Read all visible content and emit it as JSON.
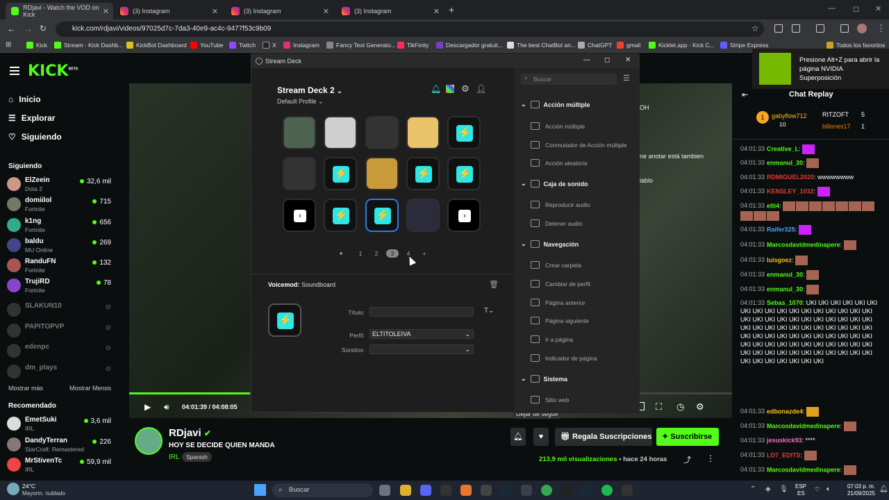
{
  "browser": {
    "tabs": [
      {
        "title": "RDjavi - Watch the VOD on Kick",
        "type": "kick",
        "active": true
      },
      {
        "title": "(3) Instagram",
        "type": "ig"
      },
      {
        "title": "(3) Instagram",
        "type": "ig"
      },
      {
        "title": "(3) Instagram",
        "type": "ig"
      }
    ],
    "url": "kick.com/rdjavi/videos/97025d7c-7da3-40e9-ac4c-9477f53c9b09",
    "bookmarks": [
      "Kick",
      "Stream - Kick Dashb...",
      "KickBot Dashboard",
      "YouTube",
      "Twitch",
      "X",
      "Instagram",
      "Fancy Text Generato...",
      "TikFinity",
      "Descargador gratuit...",
      "The best ChatBot an...",
      "ChatGPT",
      "gmail",
      "Kicklet.app - Kick C...",
      "Stripe Express"
    ],
    "all_favorites": "Todos los favoritos"
  },
  "kick": {
    "logo": "KICK",
    "logo_badge": "BETA",
    "nav": [
      "Inicio",
      "Explorar",
      "Siguiendo"
    ],
    "following_title": "Siguiendo",
    "following": [
      {
        "name": "ElZeein",
        "game": "Dota 2",
        "viewers": "32,6 mil"
      },
      {
        "name": "domiilol",
        "game": "Fortnite",
        "viewers": "715"
      },
      {
        "name": "k1ng",
        "game": "Fortnite",
        "viewers": "656"
      },
      {
        "name": "baldu",
        "game": "MU Online",
        "viewers": "269"
      },
      {
        "name": "RanduFN",
        "game": "Fortnite",
        "viewers": "132"
      },
      {
        "name": "TrujiRD",
        "game": "Fortnite",
        "viewers": "78"
      }
    ],
    "offline": [
      "SLAKUN10",
      "PAPITOPVP",
      "edenpc",
      "dm_plays"
    ],
    "show_more": "Mostrar más",
    "show_less": "Mostrar Menos",
    "recommended_title": "Recomendado",
    "recommended": [
      {
        "name": "EmetSuki",
        "game": "IRL",
        "viewers": "3,6 mil"
      },
      {
        "name": "DandyTerran",
        "game": "StarCraft: Remastered",
        "viewers": "226"
      },
      {
        "name": "MrStivenTc",
        "game": "IRL",
        "viewers": "59,9 mil"
      }
    ],
    "video": {
      "time": "04:01:39 / 04:08:05",
      "progress": 0.2
    },
    "streamer": {
      "name": "RDjavi",
      "title": "HOY SE DECIDE QUIEN MANDA",
      "category": "IRL",
      "language": "Spanish",
      "views": "213,9 mil visualizaciones",
      "ago": "hace 24 horas"
    },
    "buttons": {
      "gift": "Regala Suscripciones",
      "subscribe": "Suscribirse",
      "tooltip": "Dejar de seguir"
    },
    "overlay_text": [
      "OH",
      "ne anotar está tambien",
      "iablo"
    ]
  },
  "stream_deck": {
    "window_title": "Stream Deck",
    "device": "Stream Deck 2",
    "profile": "Default Profile",
    "pages": [
      "1",
      "2",
      "3",
      "4"
    ],
    "current_page": "3",
    "detail": {
      "plugin": "Voicemod:",
      "action": "Soundboard",
      "title_label": "Título:",
      "profile_label": "Perfil:",
      "profile_value": "ELTITOLEIVA",
      "sounds_label": "Sonidos:"
    },
    "search_placeholder": "Buscar",
    "categories": [
      {
        "name": "Acción múltiple",
        "items": [
          "Acción múltiple",
          "Conmutador de Acción múltiple",
          "Acción aleatoria"
        ]
      },
      {
        "name": "Caja de sonido",
        "items": [
          "Reproducir audio",
          "Detener audio"
        ]
      },
      {
        "name": "Navegación",
        "items": [
          "Crear carpeta",
          "Cambiar de perfil",
          "Página anterior",
          "Página siguiente",
          "Ir a página",
          "Indicador de página"
        ]
      },
      {
        "name": "Sistema",
        "items": [
          "Sitio web"
        ]
      }
    ]
  },
  "nvidia": {
    "text": "Presione Alt+Z para abrir la página NVIDIA Superposición"
  },
  "chat": {
    "title": "Chat Replay",
    "top": [
      {
        "name": "gabyflow712",
        "count": "10"
      },
      {
        "name": "RITZOFT",
        "count": "5"
      },
      {
        "name": "billones17",
        "count": "1"
      }
    ],
    "messages": [
      {
        "time": "04:01:33",
        "user": "Creative_L",
        "color": "#53fc18",
        "text": ""
      },
      {
        "time": "04:01:33",
        "user": "enmanul_30",
        "color": "#53fc18",
        "text": ""
      },
      {
        "time": "04:01:33",
        "user": "RDMIGUEL2020",
        "color": "#e53935",
        "text": "wwwwwwww"
      },
      {
        "time": "04:01:33",
        "user": "KENSLEY_1032",
        "color": "#e53935",
        "text": ""
      },
      {
        "time": "04:01:33",
        "user": "elti4",
        "color": "#53fc18",
        "text": ""
      },
      {
        "time": "04:01:33",
        "user": "Raifer325",
        "color": "#4aa3ff",
        "text": ""
      },
      {
        "time": "04:01:33",
        "user": "Marcosdavidmedinapere",
        "color": "#53fc18",
        "text": ""
      },
      {
        "time": "04:01:33",
        "user": "luisgoez",
        "color": "#f5c518",
        "text": ""
      },
      {
        "time": "04:01:33",
        "user": "enmanul_30",
        "color": "#53fc18",
        "text": ""
      },
      {
        "time": "04:01:33",
        "user": "enmanul_30",
        "color": "#53fc18",
        "text": ""
      },
      {
        "time": "04:01:33",
        "user": "Sebas_1070",
        "color": "#53fc18",
        "text": "UKI UKI UKI UKI UKI UKI UKI UKI UKI UKI UKI UKI UKI UKI UKI UKI UKI UKI UKI UKI UKI UKI UKI UKI UKI UKI UKI UKI UKI UKI UKI UKI UKI UKI UKI UKI UKI UKI UKI UKI UKI UKI UKI UKI UKI UKI UKI UKI UKI UKI UKI UKI UKI UKI UKI UKI UKI UKI UKI UKI UKI UKI UKI UKI UKI UKI UKI UKI UKI UKI UKI UKI UKI UKI UKI UKI UKI UKI UKI"
      },
      {
        "time": "04:01:33",
        "user": "edbonazde4",
        "color": "#f5c518",
        "text": ""
      },
      {
        "time": "04:01:33",
        "user": "Marcosdavidmedinapere",
        "color": "#53fc18",
        "text": ""
      },
      {
        "time": "04:01:33",
        "user": "jesuskick93",
        "color": "#ff66cc",
        "text": "****"
      },
      {
        "time": "04:01:33",
        "user": "LD7_EDITS",
        "color": "#e53935",
        "text": ""
      },
      {
        "time": "04:01:33",
        "user": "Marcosdavidmedinapere",
        "color": "#53fc18",
        "text": ""
      }
    ]
  },
  "taskbar": {
    "weather_temp": "24°C",
    "weather_desc": "Mayorm. nublado",
    "search": "Buscar",
    "lang": "ESP",
    "lang2": "ES",
    "time": "07:03 p. m.",
    "date": "21/09/2025"
  }
}
